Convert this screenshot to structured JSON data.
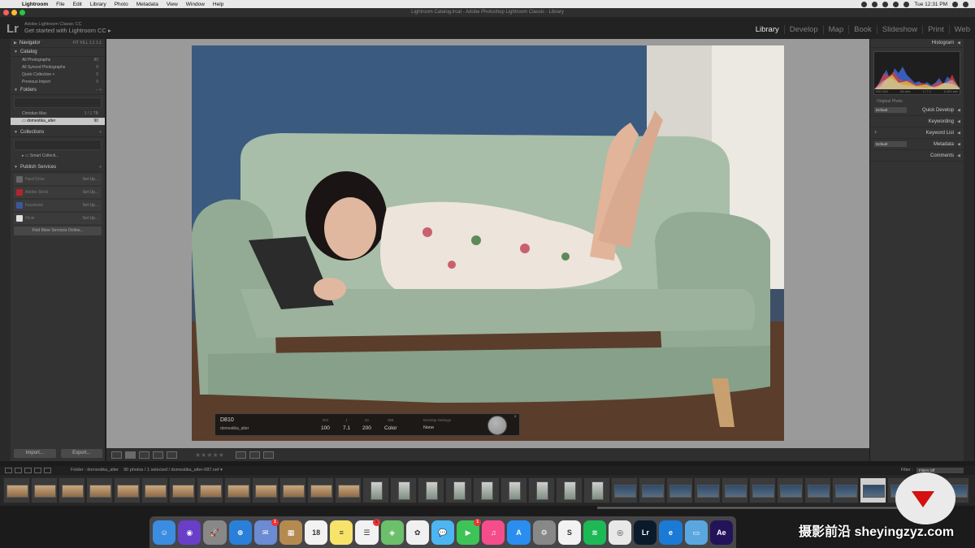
{
  "menubar": {
    "apple": "",
    "app": "Lightroom",
    "items": [
      "File",
      "Edit",
      "Library",
      "Photo",
      "Metadata",
      "View",
      "Window",
      "Help"
    ],
    "clock": "Tue 12:31 PM"
  },
  "window": {
    "title": "Lightroom Catalog.lrcat - Adobe Photoshop Lightroom Classic - Library"
  },
  "identity": {
    "logo": "Lr",
    "product": "Adobe Lightroom Classic CC",
    "cta": "Get started with Lightroom CC ▸"
  },
  "modules": [
    "Library",
    "Develop",
    "Map",
    "Book",
    "Slideshow",
    "Print",
    "Web"
  ],
  "left": {
    "navigator": {
      "title": "Navigator",
      "zoom": "FIT  FILL  1:1  1:1"
    },
    "catalog": {
      "title": "Catalog",
      "items": [
        {
          "label": "All Photographs",
          "count": "90"
        },
        {
          "label": "All Synced Photographs",
          "count": "0"
        },
        {
          "label": "Quick Collection +",
          "count": "0"
        },
        {
          "label": "Previous Import",
          "count": "0"
        }
      ]
    },
    "folders": {
      "title": "Folders",
      "volume": "Christian Mac",
      "volume_info": "1 / 1 TB",
      "folder": "domestika_alter",
      "folder_count": "90"
    },
    "collections": {
      "title": "Collections",
      "item": "Smart Collecti..."
    },
    "publish": {
      "title": "Publish Services",
      "services": [
        {
          "label": "Hard Drive",
          "setup": "Set Up...",
          "color": "#666"
        },
        {
          "label": "Adobe Stock",
          "setup": "Set Up...",
          "color": "#b3242c"
        },
        {
          "label": "Facebook",
          "setup": "Set Up...",
          "color": "#3b5998"
        },
        {
          "label": "Flickr",
          "setup": "Set Up...",
          "color": "#e0e0e0"
        }
      ],
      "more": "Find More Services Online..."
    },
    "import": "Import...",
    "export": "Export..."
  },
  "right": {
    "histogram": {
      "title": "Histogram",
      "iso": "ISO 200",
      "focal": "84 mm",
      "aperture": "f / 7.1",
      "shutter": "1/100 sec",
      "original": "Original Photo"
    },
    "panels": [
      {
        "label": "Quick Develop",
        "preset": "Default"
      },
      {
        "label": "Keywording",
        "preset": ""
      },
      {
        "label": "Keyword List",
        "preset": "+"
      },
      {
        "label": "Metadata",
        "preset": "Default"
      },
      {
        "label": "Comments",
        "preset": ""
      }
    ]
  },
  "info_overlay": {
    "camera": "D810",
    "filename": "domestika_alter",
    "iso_label": "ISO",
    "iso": "100",
    "fstop_label": "ƒ",
    "fstop": "7.1",
    "shutter_label": "Ss",
    "shutter": "200",
    "wb_label": "WB",
    "wb": "Color",
    "dev_label": "Develop Settings",
    "dev": "None"
  },
  "toolbar": {
    "stars": "★★★★★"
  },
  "filmstrip": {
    "folder": "Folder : domestika_alter",
    "info": "90 photos / 1 selected / domestika_alter-087.nef",
    "filter_label": "Filter :",
    "filter_value": "Filters Off"
  },
  "dock": [
    {
      "name": "finder",
      "color": "#3a8de0",
      "label": "☺"
    },
    {
      "name": "siri",
      "color": "#6a3fc7",
      "label": "◉"
    },
    {
      "name": "launchpad",
      "color": "#888",
      "label": "🚀"
    },
    {
      "name": "safari",
      "color": "#2a7fd8",
      "label": "⊕"
    },
    {
      "name": "photos-app",
      "color": "#6b8bd3",
      "label": "✉",
      "badge": "1"
    },
    {
      "name": "notes-bag",
      "color": "#b58a50",
      "label": "▦"
    },
    {
      "name": "calendar",
      "color": "#f2f2f2",
      "label": "18"
    },
    {
      "name": "notes",
      "color": "#f7e36a",
      "label": "≡"
    },
    {
      "name": "reminders",
      "color": "#f2f2f2",
      "label": "☰",
      "badge": "1"
    },
    {
      "name": "maps",
      "color": "#6cbf6b",
      "label": "◈"
    },
    {
      "name": "photos",
      "color": "#f0f0f0",
      "label": "✿"
    },
    {
      "name": "messages",
      "color": "#4db5f2",
      "label": "💬"
    },
    {
      "name": "facetime",
      "color": "#3ec356",
      "label": "▶",
      "badge": "1"
    },
    {
      "name": "itunes",
      "color": "#f54d8c",
      "label": "♫"
    },
    {
      "name": "app-store",
      "color": "#2a8ef0",
      "label": "A"
    },
    {
      "name": "system-preferences",
      "color": "#888",
      "label": "⚙"
    },
    {
      "name": "slack",
      "color": "#f2f2f2",
      "label": "S"
    },
    {
      "name": "spotify",
      "color": "#1db954",
      "label": "≋"
    },
    {
      "name": "chrome",
      "color": "#e8e8e8",
      "label": "◎"
    },
    {
      "name": "lightroom",
      "color": "#0b1a2b",
      "label": "Lr"
    },
    {
      "name": "edge",
      "color": "#1b7ad6",
      "label": "e"
    },
    {
      "name": "folder",
      "color": "#5aa7e0",
      "label": "▭"
    },
    {
      "name": "after-effects",
      "color": "#23145a",
      "label": "Ae"
    }
  ],
  "watermark": {
    "text": "摄影前沿 sheyingzyz.com"
  }
}
